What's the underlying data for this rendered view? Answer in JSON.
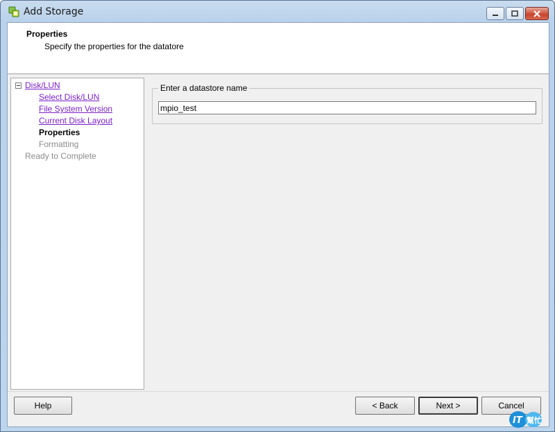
{
  "window": {
    "title": "Add Storage",
    "icon": "vsphere-storage-icon",
    "controls": [
      "minimize-icon",
      "maximize-icon",
      "close-icon"
    ]
  },
  "header": {
    "title": "Properties",
    "subtitle": "Specify the properties for the datatore"
  },
  "nav": {
    "root": "Disk/LUN",
    "items": [
      {
        "label": "Select Disk/LUN",
        "state": "link"
      },
      {
        "label": "File System Version",
        "state": "link"
      },
      {
        "label": "Current Disk Layout",
        "state": "link"
      },
      {
        "label": "Properties",
        "state": "current"
      },
      {
        "label": "Formatting",
        "state": "disabled"
      }
    ],
    "after": {
      "label": "Ready to Complete",
      "state": "disabled"
    }
  },
  "form": {
    "group_label": "Enter a datastore name",
    "datastore_name": "mpio_test"
  },
  "buttons": {
    "help": "Help",
    "back": "< Back",
    "next": "Next >",
    "cancel": "Cancel"
  },
  "watermark": {
    "text_main": "IT",
    "text_sub": "幫忙"
  },
  "colors": {
    "link": "#7a1fc9",
    "disabled": "#8a8a8a",
    "close_button": "#c8442c"
  }
}
